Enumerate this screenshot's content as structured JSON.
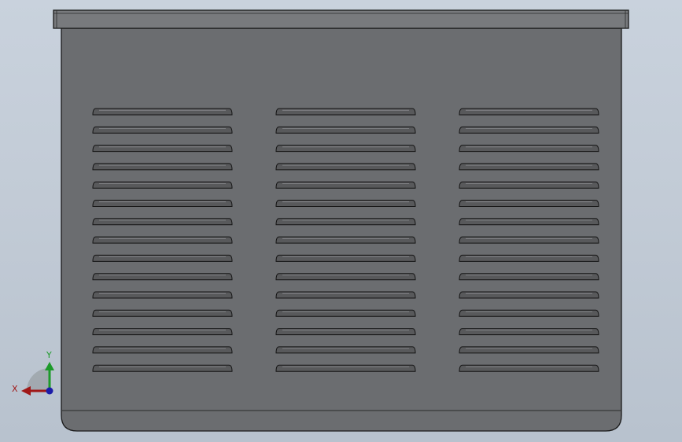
{
  "scene": {
    "view_name": "front",
    "colors": {
      "background_top": "#c9d2dd",
      "background_bottom": "#b8c2ce",
      "body_fill": "#6b6d70",
      "body_edge": "#1a1a1a",
      "lid_fill": "#787a7d",
      "slot_fill": "#58595b",
      "slot_highlight": "#8a8c8f"
    },
    "model": {
      "part": "vented-enclosure",
      "vent_groups": 3,
      "slots_per_group": 15
    },
    "triad": {
      "x_label": "X",
      "y_label": "Y",
      "x_color": "#a01818",
      "y_color": "#1c9a2a",
      "z_color": "#1c1ca8"
    }
  }
}
